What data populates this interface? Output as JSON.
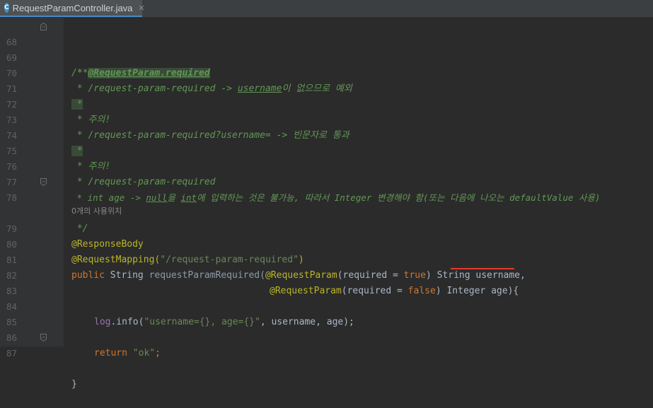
{
  "tab": {
    "title": "RequestParamController.java",
    "icon": "C",
    "close": "✕"
  },
  "line_numbers": [
    "68",
    "69",
    "70",
    "71",
    "72",
    "73",
    "74",
    "75",
    "76",
    "77",
    "78",
    "79",
    "80",
    "81",
    "82",
    "83",
    "84",
    "85",
    "86",
    "87"
  ],
  "code": {
    "l68": "/**",
    "l69_prefix": " * ",
    "l69_tag": "@RequestParam.required",
    "l70_a": " * /request-param-required -> ",
    "l70_b": "username",
    "l70_c": "이 없으므로 예외",
    "l71": " *",
    "l72": " * 주의!",
    "l73": " * /request-param-required?username= -> 빈문자로 통과",
    "l74": " *",
    "l75": " * 주의!",
    "l76": " * /request-param-required",
    "l77_a": " * int age -> ",
    "l77_b": "null",
    "l77_c": "을 ",
    "l77_d": "int",
    "l77_e": "에 입력하는 것은 불가능, 따라서 Integer 변경해야 함(또는 다음에 나오는 defaultValue 사용)",
    "l78": " */",
    "usage": "0개의 사용위치",
    "l79": "@ResponseBody",
    "l80_a": "@RequestMapping(",
    "l80_b": "\"/request-param-required\"",
    "l80_c": ")",
    "l81_kw": "public ",
    "l81_type": "String ",
    "l81_name": "requestParamRequired(",
    "l81_ann": "@RequestParam",
    "l81_p1": "(required = ",
    "l81_true": "true",
    "l81_p2": ") String username,",
    "l82_ann": "@RequestParam",
    "l82_p1": "(required = ",
    "l82_false": "false",
    "l82_p2": ") ",
    "l82_p3": "Integer age",
    "l82_p4": "){",
    "l84_a": "log",
    "l84_b": ".info(",
    "l84_c": "\"username={}, age={}\"",
    "l84_d": ", username, age);",
    "l86_kw": "return ",
    "l86_str": "\"ok\"",
    "l86_end": ";",
    "l87": "}"
  },
  "colors": {
    "background": "#2b2b2b",
    "doc": "#629755",
    "keyword": "#cc7832",
    "annotation": "#bbb529",
    "string": "#6a8759",
    "underline_red": "#e8382f"
  }
}
